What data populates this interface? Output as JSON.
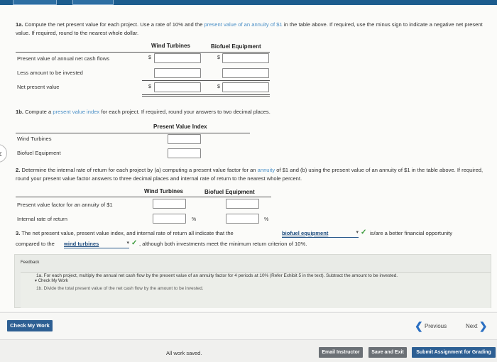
{
  "part_1a": {
    "prefix": "1a.",
    "text_a": " Compute the net present value for each project. Use a rate of 10% and the ",
    "link_text": "present value of an annuity of $1",
    "text_b": " in the table above. If required, use the minus sign to indicate a negative net present value. If required, round to the nearest whole dollar.",
    "col_1": "Wind Turbines",
    "col_2": "Biofuel Equipment",
    "rows": [
      "Present value of annual net cash flows",
      "Less amount to be invested",
      "Net present value"
    ],
    "currency": "$"
  },
  "part_1b": {
    "prefix": "1b.",
    "text_a": " Compute a ",
    "link_text": "present value index",
    "text_b": " for each project. If required, round your answers to two decimal places.",
    "col": "Present Value Index",
    "rows": [
      "Wind Turbines",
      "Biofuel Equipment"
    ]
  },
  "part_2": {
    "prefix": "2.",
    "text_a": " Determine the internal rate of return for each project by (a) computing a present value factor for an ",
    "link_1": "annuity",
    "text_b": " of $1 and (b) using the present value of an annuity of $1 in the table above. If required, round your present value factor answers to three decimal places and internal rate of return to the nearest whole percent.",
    "col_1": "Wind Turbines",
    "col_2": "Biofuel Equipment",
    "rows": [
      "Present value factor for an annuity of $1",
      "Internal rate of return"
    ],
    "percent": "%"
  },
  "part_3": {
    "prefix": "3.",
    "text_a": " The net present value, present value index, and internal rate of return all indicate that the",
    "select_1": "biofuel equipment",
    "text_b": "is/are a better financial opportunity",
    "text_c": "compared to the",
    "select_2": "wind turbines",
    "text_d": ", although both investments meet the minimum return criterion of 10%."
  },
  "feedback": {
    "title": "Feedback",
    "check_my_work": "Check My Work",
    "line_1": "1a. For each project, multiply the annual net cash flow by the present value of an annuity factor for 4 periods at 10% (Refer Exhibit 5 in the text). Subtract the amount to be invested.",
    "line_2": "1b. Divide the total present value of the net cash flow by the amount to be invested."
  },
  "nav": {
    "check_my_work": "Check My Work",
    "previous": "Previous",
    "next": "Next"
  },
  "footer": {
    "status": "All work saved.",
    "email": "Email Instructor",
    "save_exit": "Save and Exit",
    "submit": "Submit Assignment for Grading"
  }
}
